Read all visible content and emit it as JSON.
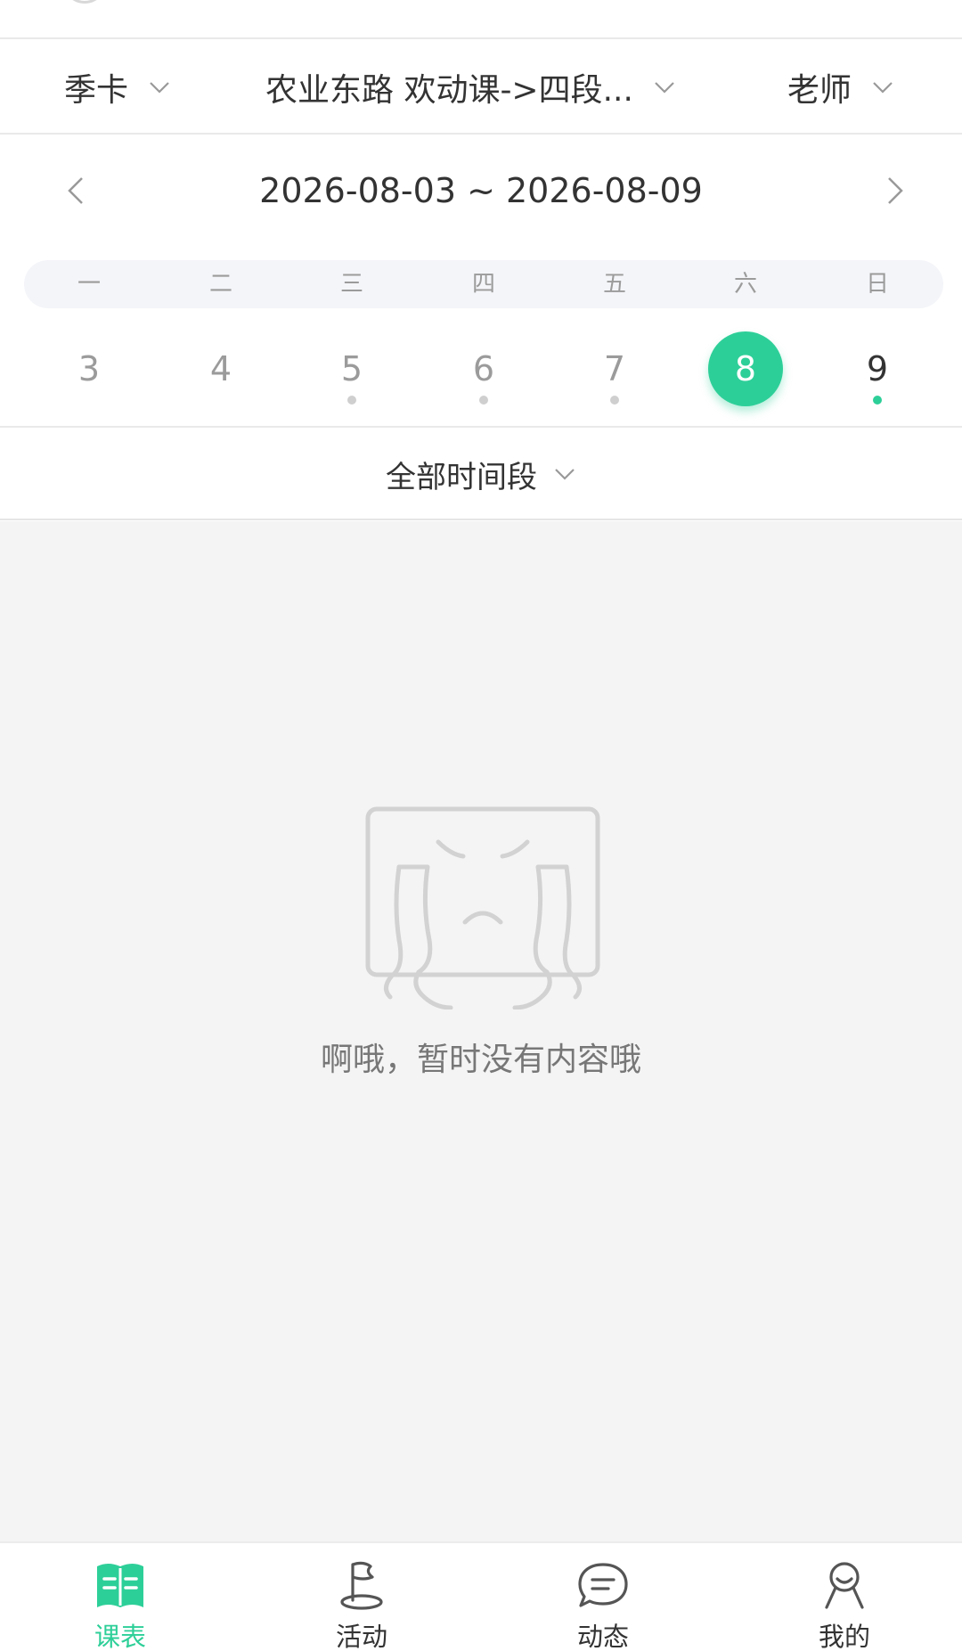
{
  "filters": {
    "card": "季卡",
    "course": "农业东路 欢动课->四段...",
    "teacher": "老师"
  },
  "week": {
    "range": "2026-08-03 ~ 2026-08-09",
    "weekdays": [
      "一",
      "二",
      "三",
      "四",
      "五",
      "六",
      "日"
    ],
    "dates": [
      "3",
      "4",
      "5",
      "6",
      "7",
      "8",
      "9"
    ],
    "selected_date": "8"
  },
  "period_filter": "全部时间段",
  "empty_state": {
    "message": "啊哦，暂时没有内容哦"
  },
  "tabs": [
    {
      "label": "课表",
      "icon": "book-icon",
      "active": true
    },
    {
      "label": "活动",
      "icon": "flag-icon",
      "active": false
    },
    {
      "label": "动态",
      "icon": "chat-bubble-icon",
      "active": false
    },
    {
      "label": "我的",
      "icon": "person-icon",
      "active": false
    }
  ],
  "colors": {
    "accent": "#2dcf98",
    "text": "#333333",
    "muted": "#9b9b9b",
    "background": "#f4f4f4"
  }
}
